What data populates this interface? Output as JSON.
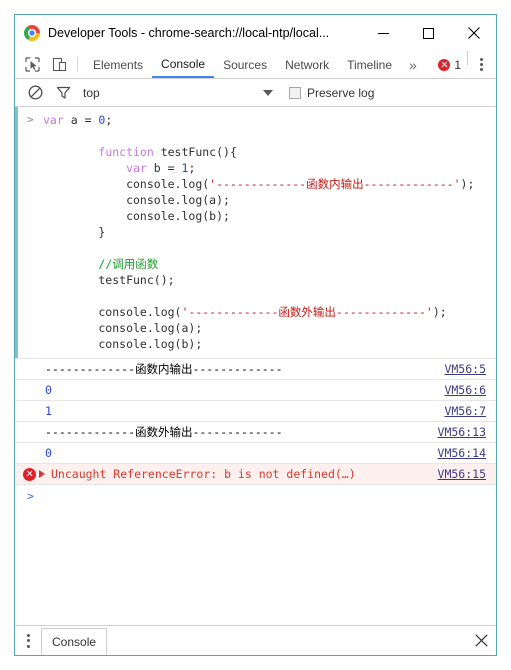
{
  "window": {
    "title": "Developer Tools - chrome-search://local-ntp/local...",
    "logo_icon": "chrome-logo-icon",
    "minimize_icon": "minimize-icon",
    "maximize_icon": "maximize-icon",
    "close_icon": "close-icon",
    "border_color": "#53a8b0"
  },
  "toolbar": {
    "inspect_icon": "inspect-element-icon",
    "device_icon": "device-toolbar-icon",
    "tabs": [
      {
        "label": "Elements",
        "active": false
      },
      {
        "label": "Console",
        "active": true
      },
      {
        "label": "Sources",
        "active": false
      },
      {
        "label": "Network",
        "active": false
      },
      {
        "label": "Timeline",
        "active": false
      }
    ],
    "overflow_label": "»",
    "error_count": "1",
    "error_icon": "error-circle-icon",
    "menu_icon": "kebab-menu-icon",
    "active_tab_color": "#4285f4",
    "error_color": "#df2227"
  },
  "filterbar": {
    "clear_icon": "clear-console-icon",
    "filter_icon": "filter-funnel-icon",
    "context": "top",
    "context_arrow_icon": "chevron-down-icon",
    "preserve_log_label": "Preserve log",
    "preserve_log_checked": false
  },
  "console": {
    "prompt_symbol": ">",
    "input_accent_color": "#7fc4cc",
    "code_lines": [
      [
        {
          "t": "var ",
          "c": "kw"
        },
        {
          "t": "a ",
          "c": "plain"
        },
        {
          "t": "= ",
          "c": "plain"
        },
        {
          "t": "0",
          "c": "num"
        },
        {
          "t": ";",
          "c": "plain"
        }
      ],
      [],
      [
        {
          "t": "        ",
          "c": "plain"
        },
        {
          "t": "function ",
          "c": "kw"
        },
        {
          "t": "testFunc(){",
          "c": "plain"
        }
      ],
      [
        {
          "t": "            ",
          "c": "plain"
        },
        {
          "t": "var ",
          "c": "kw"
        },
        {
          "t": "b = ",
          "c": "plain"
        },
        {
          "t": "1",
          "c": "num"
        },
        {
          "t": ";",
          "c": "plain"
        }
      ],
      [
        {
          "t": "            console.log(",
          "c": "plain"
        },
        {
          "t": "'-------------函数内输出-------------'",
          "c": "str"
        },
        {
          "t": ");",
          "c": "plain"
        }
      ],
      [
        {
          "t": "            console.log(a);",
          "c": "plain"
        }
      ],
      [
        {
          "t": "            console.log(b);",
          "c": "plain"
        }
      ],
      [
        {
          "t": "        }",
          "c": "plain"
        }
      ],
      [],
      [
        {
          "t": "        ",
          "c": "plain"
        },
        {
          "t": "//调用函数",
          "c": "cmt"
        }
      ],
      [
        {
          "t": "        testFunc();",
          "c": "plain"
        }
      ],
      [],
      [
        {
          "t": "        console.log(",
          "c": "plain"
        },
        {
          "t": "'-------------函数外输出-------------'",
          "c": "str"
        },
        {
          "t": ");",
          "c": "plain"
        }
      ],
      [
        {
          "t": "        console.log(a);",
          "c": "plain"
        }
      ],
      [
        {
          "t": "        console.log(b);",
          "c": "plain"
        }
      ]
    ],
    "output_rows": [
      {
        "text": "-------------函数内输出-------------",
        "link": "VM56:5",
        "type": "log"
      },
      {
        "text": "0",
        "link": "VM56:6",
        "type": "number"
      },
      {
        "text": "1",
        "link": "VM56:7",
        "type": "number"
      },
      {
        "text": "-------------函数外输出-------------",
        "link": "VM56:13",
        "type": "log"
      },
      {
        "text": "0",
        "link": "VM56:14",
        "type": "number"
      },
      {
        "text": "Uncaught ReferenceError: b is not defined(…)",
        "link": "VM56:15",
        "type": "error"
      }
    ],
    "trailing_prompt": ">"
  },
  "statusbar": {
    "menu_icon": "kebab-menu-icon",
    "drawer_tab": "Console",
    "close_icon": "close-drawer-icon"
  }
}
